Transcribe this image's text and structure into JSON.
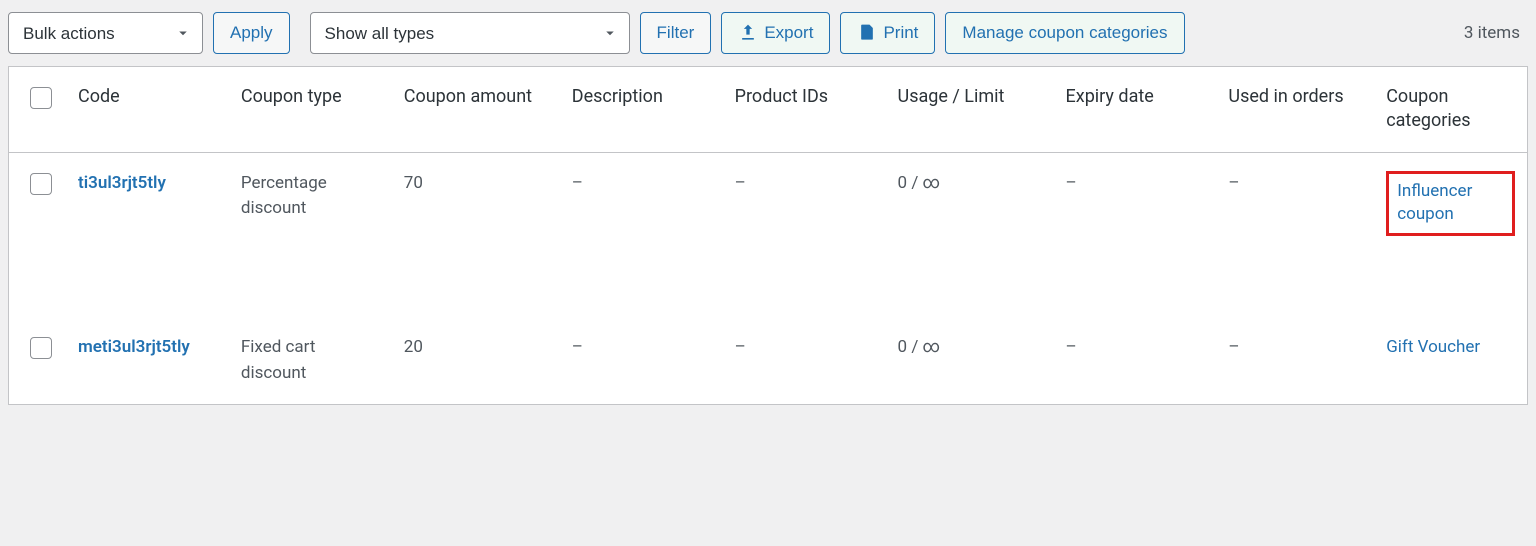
{
  "toolbar": {
    "bulk_actions_label": "Bulk actions",
    "apply_label": "Apply",
    "type_filter_label": "Show all types",
    "filter_label": "Filter",
    "export_label": "Export",
    "print_label": "Print",
    "manage_categories_label": "Manage coupon categories",
    "items_count": "3 items"
  },
  "columns": {
    "code": "Code",
    "type": "Coupon type",
    "amount": "Coupon amount",
    "description": "Description",
    "product_ids": "Product IDs",
    "usage_limit": "Usage / Limit",
    "expiry": "Expiry date",
    "used_in_orders": "Used in orders",
    "categories": "Coupon categories"
  },
  "rows": [
    {
      "code": "ti3ul3rjt5tly",
      "type": "Percentage discount",
      "amount": "70",
      "description": "–",
      "product_ids": "–",
      "usage_limit": "0 / ∞",
      "expiry": "–",
      "used_in_orders": "–",
      "category": "Influencer coupon",
      "category_highlighted": true
    },
    {
      "code": "meti3ul3rjt5tly",
      "type": "Fixed cart discount",
      "amount": "20",
      "description": "–",
      "product_ids": "–",
      "usage_limit": "0 / ∞",
      "expiry": "–",
      "used_in_orders": "–",
      "category": "Gift Voucher",
      "category_highlighted": false
    }
  ]
}
